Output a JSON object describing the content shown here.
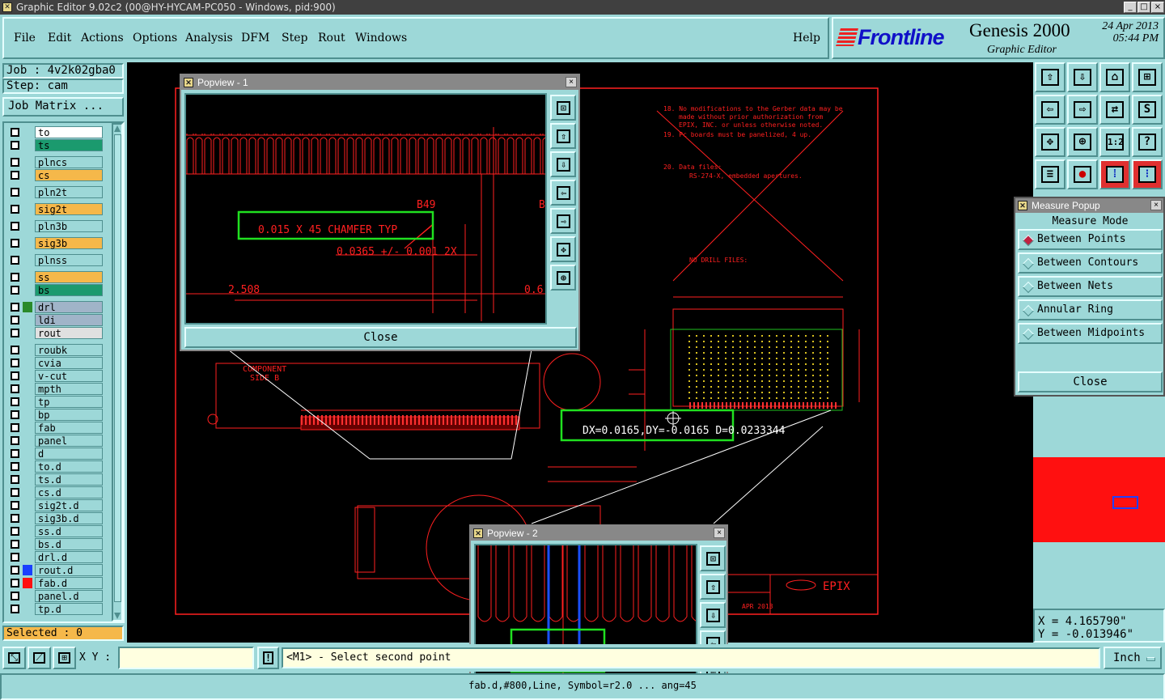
{
  "window": {
    "title": "Graphic Editor 9.02c2 (00@HY-HYCAM-PC050 - Windows, pid:900)",
    "controls": [
      "_",
      "□",
      "×"
    ]
  },
  "menu": {
    "items": [
      "File",
      "Edit",
      "Actions",
      "Options",
      "Analysis",
      "DFM",
      "Step",
      "Rout",
      "Windows"
    ],
    "help": "Help"
  },
  "brand": {
    "logo": "Frontline",
    "product": "Genesis 2000",
    "subtitle": "Graphic Editor",
    "date": "24 Apr 2013",
    "time": "05:44 PM"
  },
  "job": {
    "job_label": "Job : 4v2k02gba0",
    "step_label": "Step: cam",
    "matrix_button": "Job Matrix ..."
  },
  "layers": [
    {
      "name": "to",
      "color": "#ffffff"
    },
    {
      "name": "ts",
      "color": "#1b9a6e"
    },
    {
      "name": "plncs",
      "color": "#9dd8d8"
    },
    {
      "name": "cs",
      "color": "#f5b84a"
    },
    {
      "name": "pln2t",
      "color": "#9dd8d8"
    },
    {
      "name": "sig2t",
      "color": "#f5b84a"
    },
    {
      "name": "pln3b",
      "color": "#9dd8d8"
    },
    {
      "name": "sig3b",
      "color": "#f5b84a"
    },
    {
      "name": "plnss",
      "color": "#9dd8d8"
    },
    {
      "name": "ss",
      "color": "#f5b84a"
    },
    {
      "name": "bs",
      "color": "#1b9a6e"
    },
    {
      "name": "drl",
      "color": "#a0b4c8",
      "swatch": "#2a8a2a"
    },
    {
      "name": "ldi",
      "color": "#a0b4c8"
    },
    {
      "name": "rout",
      "color": "#e0e0e0"
    },
    {
      "name": "roubk",
      "color": "#9dd8d8"
    },
    {
      "name": "cvia",
      "color": "#9dd8d8"
    },
    {
      "name": "v-cut",
      "color": "#9dd8d8"
    },
    {
      "name": "mpth",
      "color": "#9dd8d8"
    },
    {
      "name": "tp",
      "color": "#9dd8d8"
    },
    {
      "name": "bp",
      "color": "#9dd8d8"
    },
    {
      "name": "fab",
      "color": "#9dd8d8"
    },
    {
      "name": "panel",
      "color": "#9dd8d8"
    },
    {
      "name": "d",
      "color": "#9dd8d8"
    },
    {
      "name": "to.d",
      "color": "#9dd8d8"
    },
    {
      "name": "ts.d",
      "color": "#9dd8d8"
    },
    {
      "name": "cs.d",
      "color": "#9dd8d8"
    },
    {
      "name": "sig2t.d",
      "color": "#9dd8d8"
    },
    {
      "name": "sig3b.d",
      "color": "#9dd8d8"
    },
    {
      "name": "ss.d",
      "color": "#9dd8d8"
    },
    {
      "name": "bs.d",
      "color": "#9dd8d8"
    },
    {
      "name": "drl.d",
      "color": "#9dd8d8"
    },
    {
      "name": "rout.d",
      "color": "#9dd8d8",
      "swatch": "#1a40ff"
    },
    {
      "name": "fab.d",
      "color": "#9dd8d8",
      "swatch": "#ff1010"
    },
    {
      "name": "panel.d",
      "color": "#9dd8d8"
    },
    {
      "name": "tp.d",
      "color": "#9dd8d8"
    }
  ],
  "selected_label": "Selected : 0",
  "measure_popup": {
    "title": "Measure Popup",
    "mode_label": "Measure Mode",
    "options": [
      "Between Points",
      "Between Contours",
      "Between Nets",
      "Annular Ring",
      "Between Midpoints"
    ],
    "selected_option": "Between Points",
    "close": "Close"
  },
  "popview1": {
    "title": "Popview - 1",
    "close": "Close",
    "text_chamfer": "0.015 X 45 CHAMFER TYP",
    "text_dim": "0.0365 +/- 0.001 2X",
    "text_b49": "B49",
    "text_b": "B",
    "text_2508": "2.508",
    "text_06": "0.6"
  },
  "popview2": {
    "title": "Popview - 2"
  },
  "measure_result": "DX=0.0165,DY=-0.0165 D=0.0233344",
  "drawing": {
    "component": "COMPONENT",
    "side_b": "SIDE B",
    "notes_18": "18. No modifications to the Gerber data may be",
    "notes_18b": "made without prior authorization from",
    "notes_18c": "EPIX, INC. or unless otherwise noted.",
    "notes_19": "19. Pc boards must be panelized, 4 up.",
    "notes_20": "20. Data files:",
    "notes_rs": "RS-274-X, embedded apertures.",
    "no_drill": "NO DRILL FILES:",
    "epix": "EPIX",
    "apr": "APR 2013"
  },
  "coordinates": {
    "x": "X = 4.165790\"",
    "y": "Y = -0.013946\""
  },
  "xy_label": "X Y :",
  "prompt": "<M1> - Select second point",
  "unit": "Inch",
  "status": "fab.d,#800,Line, Symbol=r2.0 ... ang=45",
  "colors": {
    "panel_bg": "#9dd8d8",
    "canvas_bg": "#000000",
    "drawing_red": "#ff2020",
    "highlight_green": "#20e020",
    "selected_bg": "#f5b84a"
  }
}
